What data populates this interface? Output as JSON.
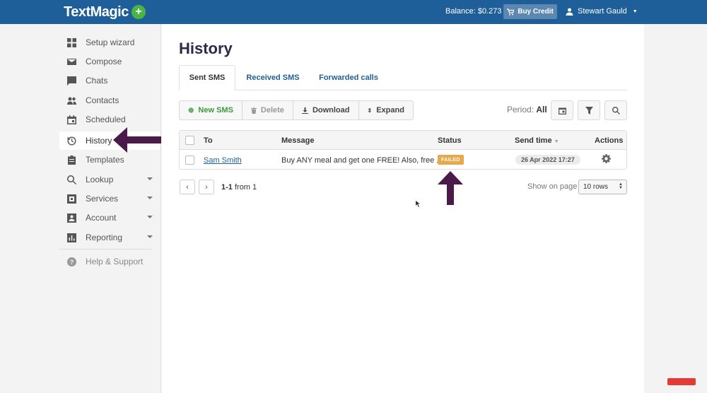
{
  "topbar": {
    "logo": "TextMagic",
    "logo_plus": "+",
    "balance": "Balance: $0.273",
    "buy_credit": "Buy Credit",
    "user_name": "Stewart Gauld"
  },
  "sidebar": {
    "items": [
      {
        "label": "Setup wizard",
        "icon": "grid-icon"
      },
      {
        "label": "Compose",
        "icon": "envelope-icon"
      },
      {
        "label": "Chats",
        "icon": "chat-bubble-icon"
      },
      {
        "label": "Contacts",
        "icon": "people-icon"
      },
      {
        "label": "Scheduled",
        "icon": "calendar-icon"
      },
      {
        "label": "History",
        "icon": "history-icon"
      },
      {
        "label": "Templates",
        "icon": "clipboard-icon"
      },
      {
        "label": "Lookup",
        "icon": "search-icon"
      },
      {
        "label": "Services",
        "icon": "box-icon"
      },
      {
        "label": "Account",
        "icon": "account-icon"
      },
      {
        "label": "Reporting",
        "icon": "bar-chart-icon"
      },
      {
        "label": "Help & Support",
        "icon": "help-icon"
      }
    ]
  },
  "main": {
    "title": "History",
    "tabs": [
      "Sent SMS",
      "Received SMS",
      "Forwarded calls"
    ],
    "toolbar": {
      "new_sms": "New SMS",
      "delete": "Delete",
      "download": "Download",
      "expand": "Expand"
    },
    "period_label": "Period:",
    "period_value": "All",
    "table": {
      "headers": [
        "To",
        "Message",
        "Status",
        "Send time",
        "Actions"
      ],
      "rows": [
        {
          "to": "Sam Smith",
          "message": "Buy ANY meal and get one FREE! Also, free ...",
          "status": "FAILED",
          "send_time": "26 Apr 2022 17:27"
        }
      ]
    },
    "pagination": {
      "range": "1-1",
      "from_text": "from 1",
      "show_on_page": "Show on page",
      "rows_option": "10 rows"
    }
  },
  "colors": {
    "topbar": "#1e5f99",
    "accent_green": "#4bb543",
    "failed_badge": "#e8a84c",
    "annotation_arrow": "#4a1a4a"
  }
}
